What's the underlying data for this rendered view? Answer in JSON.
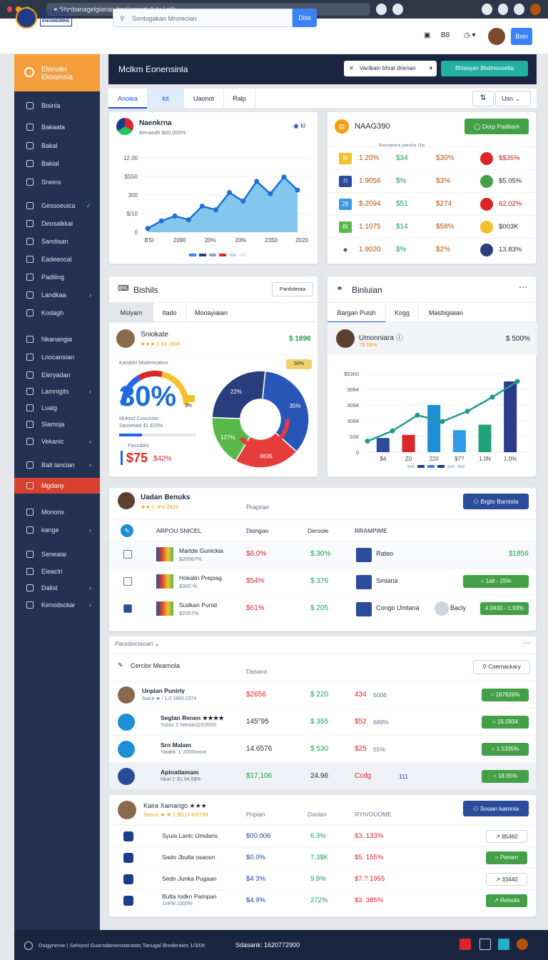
{
  "browser": {
    "url": "Stanbanagelgianan benkomedy/luly | eilk"
  },
  "app": {
    "logo_line1": "NANAKI",
    "logo_line2": "ENGINEMING",
    "search_placeholder": "Sontugakan Mrorecian",
    "search_button": "Diss",
    "header_icon_label": "B8",
    "header_button": "Bsin"
  },
  "sidebar": {
    "header": [
      "Elonulei",
      "Ekoomsia"
    ],
    "items": [
      {
        "label": "Bisinla",
        "top": 137
      },
      {
        "label": "Bakaata",
        "top": 167
      },
      {
        "label": "Bakal",
        "top": 193
      },
      {
        "label": "Bakial",
        "top": 218
      },
      {
        "label": "Sneins",
        "top": 244
      },
      {
        "label": "Gessoeuica",
        "top": 277,
        "check": true
      },
      {
        "label": "Deosalkkal",
        "top": 302
      },
      {
        "label": "Sandisan",
        "top": 327
      },
      {
        "label": "Eadeeocal",
        "top": 352
      },
      {
        "label": "Padiling",
        "top": 377
      },
      {
        "label": "Landkaa",
        "top": 402,
        "chev": true
      },
      {
        "label": "Kodagh",
        "top": 427
      },
      {
        "label": "Nkanangia",
        "top": 464
      },
      {
        "label": "Lnocansian",
        "top": 489
      },
      {
        "label": "Eleryadan",
        "top": 514
      },
      {
        "label": "Lamnigits",
        "top": 537,
        "chev": true
      },
      {
        "label": "Luaig",
        "top": 560
      },
      {
        "label": "Slamoja",
        "top": 583
      },
      {
        "label": "Vekanic",
        "top": 607,
        "chev": true
      },
      {
        "label": "Balt lancian",
        "top": 640,
        "chev": true
      },
      {
        "label": "Mgdany",
        "top": 669,
        "active": true
      },
      {
        "label": "Monons",
        "top": 706
      },
      {
        "label": "kange",
        "top": 731,
        "chev": true
      },
      {
        "label": "Senealai",
        "top": 765
      },
      {
        "label": "Eleaclri",
        "top": 789
      },
      {
        "label": "Dalist",
        "top": 812,
        "chev": true
      },
      {
        "label": "Kenodsckar",
        "top": 836,
        "chev": true
      }
    ]
  },
  "banner": {
    "title": "Mclkm Eonensinla",
    "select": "Vaclkain bhral drienan",
    "button": "Bhlasyan Bbdmousetia"
  },
  "tabs": {
    "items": [
      "Anoiea",
      "kit",
      "Uaonot",
      "Ralp"
    ],
    "right": "Usn"
  },
  "card1": {
    "title": "Naenkrna",
    "subtitle": "Benasdh $00,000%",
    "legend_label": "kl"
  },
  "chart_data": [
    {
      "type": "area",
      "title": "",
      "x": [
        "BSI",
        "2090",
        "20%",
        "20%",
        "2350",
        "2020"
      ],
      "values": [
        60,
        180,
        260,
        200,
        420,
        360,
        640,
        500,
        820,
        620,
        890,
        680
      ],
      "ylim": [
        0,
        1200
      ],
      "yticks": [
        "12.00",
        "$S50",
        "300",
        "$/10",
        "0"
      ]
    },
    {
      "type": "pie",
      "values": [
        35,
        22,
        17,
        26
      ],
      "labels": [
        "35%",
        "8836",
        "127%",
        "22%"
      ],
      "colors": [
        "#2756b8",
        "#e63c3c",
        "#58b84a",
        "#2a3e7d"
      ]
    },
    {
      "type": "bar",
      "categories": [
        "$4",
        "Z0",
        "220",
        "$7?",
        "1.0N",
        "1.0%"
      ],
      "values": [
        180,
        220,
        600,
        280,
        350,
        900
      ],
      "line": [
        140,
        270,
        470,
        390,
        520,
        700,
        900
      ],
      "yticks": [
        "$5300",
        "3094",
        "3094",
        "3094",
        "S06",
        "0"
      ]
    }
  ],
  "card2": {
    "title": "NAAG390",
    "header_text": "Pantatara pieska Dis",
    "button": "Dorp Padtiam",
    "rows": [
      {
        "badge": "Bi",
        "bcol": "#f2c12e",
        "v1": "1.20%",
        "v2": "$34",
        "v3": "$30%",
        "icol": "#dc2626",
        "v4": "$$35%"
      },
      {
        "badge": "I’l",
        "bcol": "#2b4b9b",
        "v1": "1.9056",
        "v2": "$%",
        "v3": "$3%",
        "icol": "#43a047",
        "v4": "$5.05%"
      },
      {
        "badge": "26",
        "bcol": "#3b9ae1",
        "v1": "$.2094",
        "v2": "$51",
        "v3": "$274",
        "icol": "#dc2626",
        "v4": "62.02%"
      },
      {
        "badge": "Bi",
        "bcol": "#58b84a",
        "v1": "1.1075",
        "v2": "$14",
        "v3": "$58%",
        "icol": "#f2c12e",
        "v4": "$003K"
      },
      {
        "badge": "◆",
        "bcol": "#ffffff",
        "v1": "1.9020",
        "v2": "$%",
        "v3": "$2%",
        "icol": "#2a3e7d",
        "v4": "13.83%"
      }
    ]
  },
  "card3": {
    "title": "Bishils",
    "button": "Pardoleota",
    "tabs": [
      "Mslyam",
      "Itado",
      "Mooayiaian"
    ],
    "person": "Sniokate",
    "rating": "★★★ 1 83 2606",
    "amount": "$ 1896",
    "sub": "Karslekt Miolemcation",
    "big": "30%",
    "sm1": "3%",
    "sm2": "Mokesf Coucician",
    "sm3": "Saonetaid $1.$15%",
    "small_label": "Paundahi",
    "price": "$75",
    "pct": "$42%",
    "pie_badge": "50%"
  },
  "card4": {
    "title": "Binluian",
    "tabs": [
      "Bargan Pulsh",
      "Kogg",
      "Masbigiaian"
    ],
    "person": "Umonniara",
    "sub": "78.5$%",
    "amount": "$ 500%"
  },
  "card5": {
    "name": "Uadan Benuks",
    "rating": "★★ 1’.4% 2826",
    "col": "Prapran",
    "button": "Brgto Bamisla",
    "headers": [
      "ARPOU SNICEL",
      "Disngan",
      "Dersoie",
      "RRAMPIME"
    ],
    "rows": [
      {
        "name": "Martde Gunickia",
        "sub": "$20567%",
        "v1": "$6.0%",
        "v2": "$.30%",
        "p": "Rateo",
        "v3": "$1856",
        "bg": "#f8fafc"
      },
      {
        "name": "Hokalin Prepiag",
        "sub": "$300 %",
        "v1": "$54%",
        "v2": "$ 376",
        "p": "Smiana",
        "v3": "○ 1atl - 25%"
      },
      {
        "name": "Sudkan Punid",
        "sub": "$2057%",
        "v1": "$61%",
        "v2": "$ 205",
        "p": "Congo Umtana",
        "p2": "Bacly",
        "v3": "4.0430 - 1.93%"
      }
    ]
  },
  "card6": {
    "filter": "Pacssbictacian",
    "title": "Cerclor Mearnola",
    "col": "Dasana",
    "button": "Coernackary",
    "rows": [
      {
        "name": "Unpian Punirly",
        "sub": "Saice ★ / 1.0 1863 2374",
        "v1": "$2656",
        "v2": "$ 220",
        "v3": "434",
        "v4": "5006",
        "b": "○ 167826%"
      },
      {
        "name": "Seglan Renen ★★★★",
        "sub": "Yusoc 1’ Nenian(22/2020",
        "v1": "145°95",
        "v2": "$ 355",
        "v3": "$52",
        "v4": "689%",
        "b": "○ 16.0934"
      },
      {
        "name": "Srn Malam",
        "sub": "Yatahk’ 1’ 2000nnsm",
        "v1": "14.6576",
        "v2": "$ 530",
        "v3": "$25",
        "v4": "55%",
        "b": "○ 1.5335%"
      },
      {
        "name": "Aplnatlamam",
        "sub": "Nkal 1’ $1.94.6$%",
        "v1": "$17,106",
        "v2": "24.96",
        "v3": "Ccdg",
        "v4": "111",
        "b": "○ 18.65%"
      }
    ]
  },
  "card7": {
    "name": "Kaira Xamarigo ★★★",
    "sub": "Seeco ★ ★ 1 $G17 8/2793",
    "cols": [
      "Pnpian",
      "Dsntan",
      "RYIVOUOME"
    ],
    "button": "Sooan kamnia",
    "rows": [
      {
        "name": "Syuia Lanlc Umdans",
        "sub": "",
        "v1": "$00.006",
        "v2": "6.3%",
        "v3": "$3. 133%",
        "b": "↗ 85460",
        "bt": "o"
      },
      {
        "name": "Sado Jbutla osaosn",
        "sub": "",
        "v1": "$0.0%",
        "v2": "7.3$K",
        "v3": "$5. 155%",
        "b": "○ Pemen",
        "bt": "g"
      },
      {
        "name": "Sedn Junka Pugaan",
        "sub": "",
        "v1": "$4 3%",
        "v2": "9.9%",
        "v3": "$7.? 1955",
        "b": "↗ 33440",
        "bt": "o"
      },
      {
        "name": "Bulta Iodkn Pampan",
        "sub": "1z4/5/ 2300%",
        "v1": "$4.9%",
        "v2": "272%",
        "v3": "$3. 385%",
        "b": "↗ Reloula",
        "bt": "g"
      }
    ]
  },
  "footer": {
    "left": "Dsigyneme | Sehiyml Guarsdamenstanasts Tanugal Brederaies 1/3/06",
    "center": "Sdasank: 1620772900"
  }
}
